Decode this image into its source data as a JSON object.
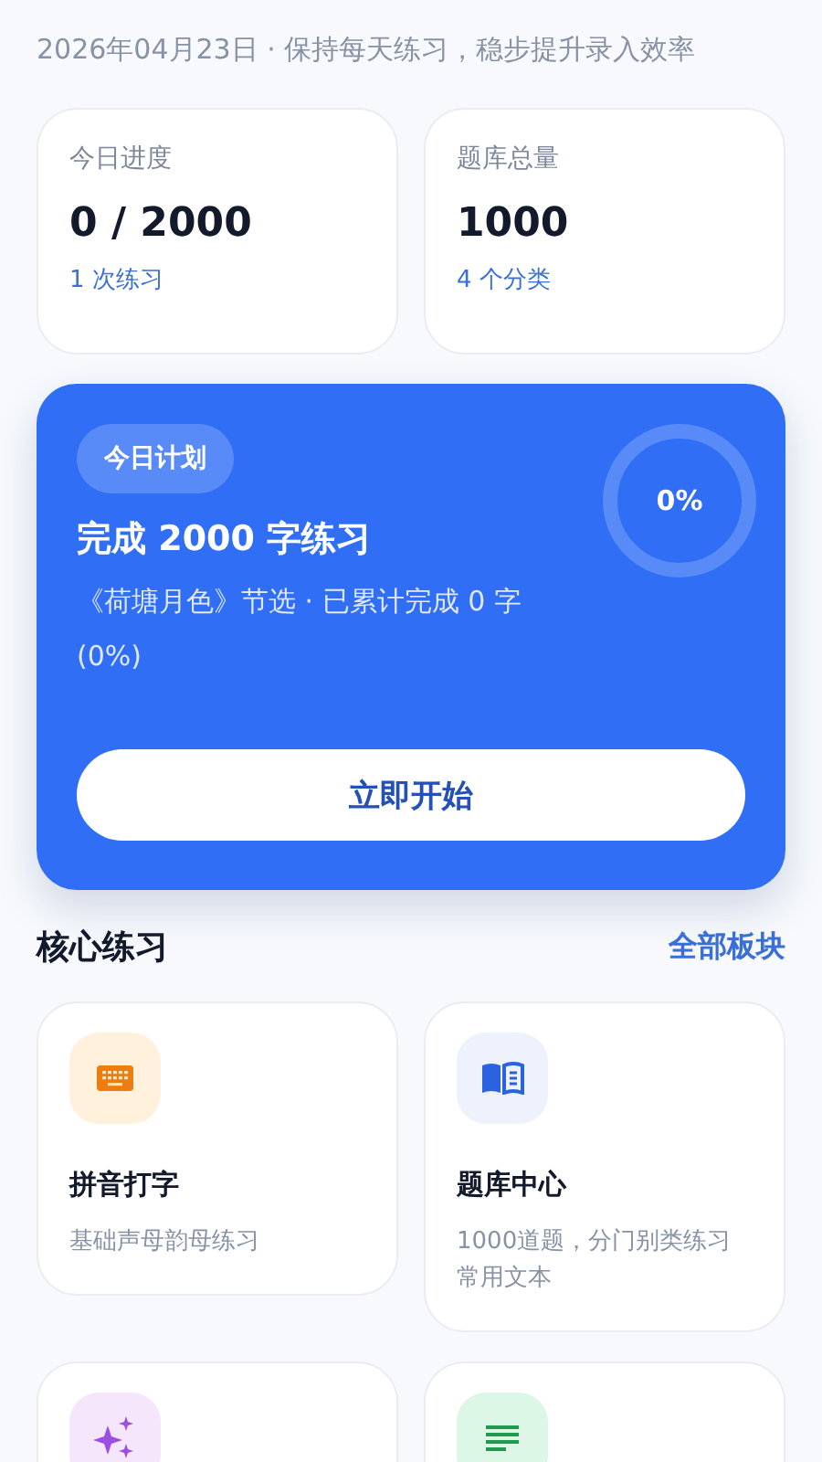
{
  "subtitle": "2026年04月23日 · 保持每天练习，稳步提升录入效率",
  "stats": [
    {
      "label": "今日进度",
      "value": "0 / 2000",
      "note": "1 次练习"
    },
    {
      "label": "题库总量",
      "value": "1000",
      "note": "4 个分类"
    }
  ],
  "plan": {
    "badge": "今日计划",
    "title": "完成 2000 字练习",
    "description": "《荷塘月色》节选 · 已累计完成 0 字 (0%)",
    "percent": "0%",
    "button": "立即开始"
  },
  "section": {
    "title": "核心练习",
    "link": "全部板块"
  },
  "features": [
    {
      "kind": "keyboard",
      "title": "拼音打字",
      "description": "基础声母韵母练习"
    },
    {
      "kind": "book",
      "title": "题库中心",
      "description": "1000道题，分门别类练习常用文本"
    },
    {
      "kind": "sparkle"
    },
    {
      "kind": "lines"
    }
  ]
}
